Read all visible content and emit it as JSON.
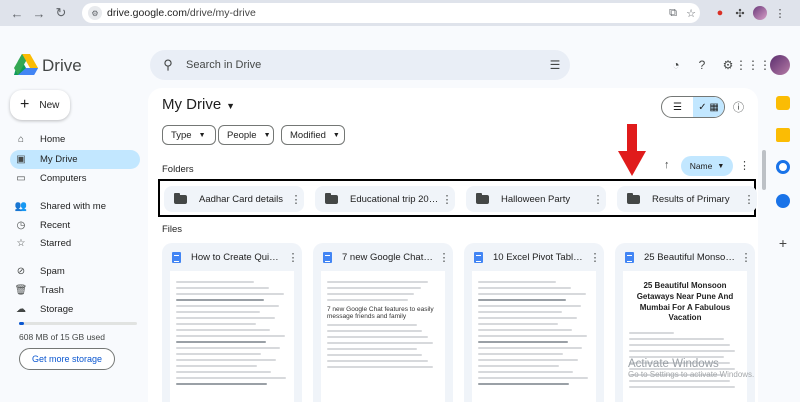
{
  "browser": {
    "url_host": "drive.google.com",
    "url_path": "/drive/my-drive"
  },
  "app": {
    "brand": "Drive",
    "search_placeholder": "Search in Drive"
  },
  "sidebar": {
    "new_label": "New",
    "items": [
      {
        "label": "Home",
        "icon": "home-icon"
      },
      {
        "label": "My Drive",
        "icon": "my-drive-icon",
        "active": true
      },
      {
        "label": "Computers",
        "icon": "computers-icon"
      },
      {
        "label": "Shared with me",
        "icon": "shared-icon"
      },
      {
        "label": "Recent",
        "icon": "clock-icon"
      },
      {
        "label": "Starred",
        "icon": "star-icon"
      },
      {
        "label": "Spam",
        "icon": "spam-icon"
      },
      {
        "label": "Trash",
        "icon": "trash-icon"
      },
      {
        "label": "Storage",
        "icon": "cloud-icon"
      }
    ],
    "storage_text": "608 MB of 15 GB used",
    "storage_fraction": 0.04,
    "storage_button": "Get more storage"
  },
  "main": {
    "title": "My Drive",
    "filters": [
      "Type",
      "People",
      "Modified"
    ],
    "folders_label": "Folders",
    "sort_label": "Name",
    "folders": [
      "Aadhar Card details",
      "Educational trip 20…",
      "Halloween Party",
      "Results of Primary"
    ],
    "files_label": "Files",
    "files": [
      {
        "name": "How to Create Qui…"
      },
      {
        "name": "7 new Google Chat…",
        "preview_heading": "7 new Google Chat features to easily message friends and family"
      },
      {
        "name": "10 Excel Pivot Tabl…"
      },
      {
        "name": "25 Beautiful Monso…",
        "preview_title": "25 Beautiful Monsoon Getaways Near Pune And Mumbai For A Fabulous Vacation"
      }
    ]
  },
  "overlay": {
    "watermark_title": "Activate Windows",
    "watermark_sub": "Go to Settings to activate Windows.",
    "arrow_color": "#e01b1b"
  }
}
